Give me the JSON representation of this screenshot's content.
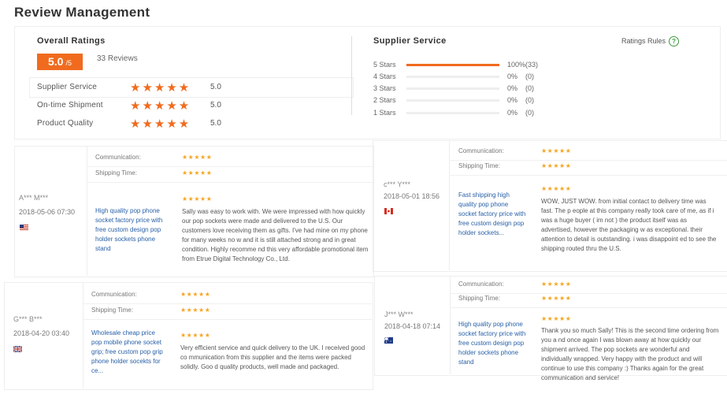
{
  "page_title": "Review Management",
  "overall": {
    "heading": "Overall Ratings",
    "score": "5.0",
    "score_suffix": "/5",
    "reviews": "33 Reviews",
    "items": [
      {
        "label": "Supplier Service",
        "value": "5.0"
      },
      {
        "label": "On-time Shipment",
        "value": "5.0"
      },
      {
        "label": "Product Quality",
        "value": "5.0"
      }
    ]
  },
  "supplier": {
    "heading": "Supplier Service",
    "rules_label": "Ratings Rules",
    "rules_icon": "?",
    "rows": [
      {
        "label": "5 Stars",
        "pct": "100%(33)",
        "fraction": 1.0
      },
      {
        "label": "4 Stars",
        "pct": "0%",
        "count": "(0)",
        "fraction": 0
      },
      {
        "label": "3 Stars",
        "pct": "0%",
        "count": "(0)",
        "fraction": 0
      },
      {
        "label": "2 Stars",
        "pct": "0%",
        "count": "(0)",
        "fraction": 0
      },
      {
        "label": "1 Stars",
        "pct": "0%",
        "count": "(0)",
        "fraction": 0
      }
    ]
  },
  "labels": {
    "communication": "Communication:",
    "shipping": "Shipping Time:"
  },
  "stars_small": "★★★★★",
  "stars_big": "★★★★★",
  "reviews": [
    {
      "user": "A*** M***",
      "date": "2018-05-06 07:30",
      "flag": "us",
      "product": "High quality pop phone socket factory price with free custom design pop holder sockets phone stand",
      "comment": "Sally was easy to work with. We were impressed with how quickly our pop sockets were made and delivered to the U.S. Our customers love receiving them as gifts. I've had mine on my phone for many weeks no w and it is still attached strong and in great condition. Highly recomme nd this very affordable promotional item from Etrue Digital Technology Co., Ltd."
    },
    {
      "user": "c*** Y***",
      "date": "2018-05-01 18:56",
      "flag": "ca",
      "product": "Fast shipping high quality pop phone socket factory price with free custom design pop holder sockets...",
      "comment": "WOW, JUST WOW. from initial contact to delivery time was fast. The p eople at this company really took care of me, as if i was a huge buyer ( im not ) the product itself was as advertised, however the packaging w as exceptional. their attention to detail is outstanding. i was disappoint ed to see the shipping routed thru the U.S."
    },
    {
      "user": "G*** B***",
      "date": "2018-04-20 03:40",
      "flag": "gb",
      "product": "Wholesale cheap price pop mobile phone socket grip; free custom pop grip phone holder socekts for ce...",
      "comment": "Very efficient service and quick delivery to the UK. I received good co mmunication from this supplier and the items were packed solidly. Goo d quality products, well made and packaged."
    },
    {
      "user": "J*** W***",
      "date": "2018-04-18 07:14",
      "flag": "au",
      "product": "High quality pop phone socket factory price with free custom design pop holder sockets phone stand",
      "comment": "Thank you so much Sally! This is the second time ordering from you a nd once again I was blown away at how quickly our shipment arrived. The pop sockets are wonderful and individually wrapped. Very happy with the product and will continue to use this company :) Thanks again for the great communication and service!"
    }
  ]
}
